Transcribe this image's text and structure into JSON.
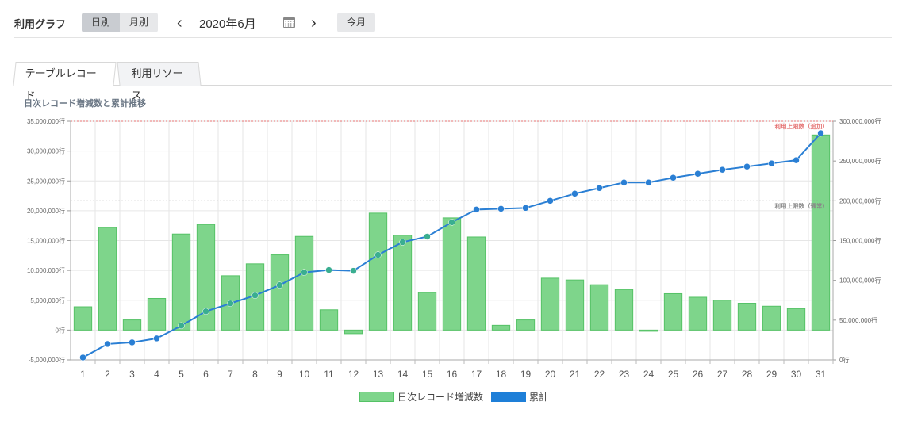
{
  "header": {
    "title": "利用グラフ",
    "daily_label": "日別",
    "monthly_label": "月別",
    "prev_icon": "‹",
    "month_text": "2020年6月",
    "next_icon": "›",
    "today_label": "今月"
  },
  "tabs": [
    {
      "label": "テーブルレコード"
    },
    {
      "label": "利用リソース"
    }
  ],
  "chart_title": "日次レコード増減数と累計推移",
  "colors": {
    "bar_fill": "#7ed58b",
    "bar_stroke": "#55c266",
    "line": "#2a7fd4",
    "point_early": "#2a7fd4",
    "point_mid": "#3aae90",
    "limit_added": "#e57373",
    "limit_normal": "#888888"
  },
  "chart_data": {
    "type": "bar",
    "title": "日次レコード増減数と累計推移",
    "categories": [
      "1",
      "2",
      "3",
      "4",
      "5",
      "6",
      "7",
      "8",
      "9",
      "10",
      "11",
      "12",
      "13",
      "14",
      "15",
      "16",
      "17",
      "18",
      "19",
      "20",
      "21",
      "22",
      "23",
      "24",
      "25",
      "26",
      "27",
      "28",
      "29",
      "30",
      "31"
    ],
    "series": [
      {
        "name": "日次レコード増減数",
        "type": "bar",
        "axis": "left",
        "values": [
          3900000,
          17200000,
          1700000,
          5300000,
          16100000,
          17700000,
          9100000,
          11100000,
          12600000,
          15700000,
          3400000,
          -600000,
          19600000,
          15900000,
          6300000,
          18800000,
          15600000,
          800000,
          1700000,
          8700000,
          8400000,
          7600000,
          6800000,
          -200000,
          6100000,
          5500000,
          5000000,
          4500000,
          4000000,
          3600000,
          32700000
        ]
      },
      {
        "name": "累計",
        "type": "line",
        "axis": "right",
        "values": [
          3000000,
          20000000,
          22000000,
          27000000,
          43000000,
          61000000,
          71000000,
          81000000,
          94000000,
          110000000,
          113000000,
          112000000,
          132000000,
          148000000,
          155000000,
          173000000,
          189000000,
          190000000,
          191000000,
          200000000,
          209000000,
          216000000,
          223000000,
          223000000,
          229000000,
          234000000,
          239000000,
          243000000,
          247000000,
          251000000,
          285000000
        ]
      }
    ],
    "y_left": {
      "min": -5000000,
      "max": 35000000,
      "ticks": [
        "35,000,000行",
        "30,000,000行",
        "25,000,000行",
        "20,000,000行",
        "15,000,000行",
        "10,000,000行",
        "5,000,000行",
        "0行",
        "-5,000,000行"
      ],
      "tick_values": [
        35000000,
        30000000,
        25000000,
        20000000,
        15000000,
        10000000,
        5000000,
        0,
        -5000000
      ]
    },
    "y_right": {
      "min": 0,
      "max": 300000000,
      "ticks": [
        "300,000,000行",
        "250,000,000行",
        "200,000,000行",
        "150,000,000行",
        "100,000,000行",
        "50,000,000行",
        "0行"
      ],
      "tick_values": [
        300000000,
        250000000,
        200000000,
        150000000,
        100000000,
        50000000,
        0
      ]
    },
    "limits": [
      {
        "label": "利用上限数（追加）",
        "value": 300000000,
        "color": "#e57373"
      },
      {
        "label": "利用上限数（通常）",
        "value": 200000000,
        "color": "#888888"
      }
    ],
    "legend": [
      {
        "label": "日次レコード増減数",
        "color": "#7ed58b"
      },
      {
        "label": "累計",
        "color": "#1e7fd8"
      }
    ],
    "grid": true,
    "legend_position": "bottom"
  }
}
